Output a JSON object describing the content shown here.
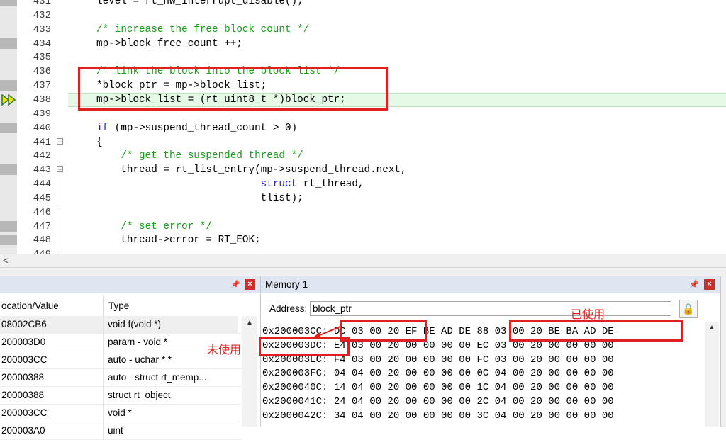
{
  "editor": {
    "lines": [
      {
        "num": "431",
        "code": "level = rt_hw_interrupt_disable();",
        "kind": "code",
        "marker": "bp"
      },
      {
        "num": "432",
        "code": "",
        "kind": "code",
        "marker": "none"
      },
      {
        "num": "433",
        "code": "/* increase the free block count */",
        "kind": "comment",
        "marker": "none"
      },
      {
        "num": "434",
        "code": "mp->block_free_count ++;",
        "kind": "code",
        "marker": "bp"
      },
      {
        "num": "435",
        "code": "",
        "kind": "code",
        "marker": "none"
      },
      {
        "num": "436",
        "code": "/* link the block into the block list */",
        "kind": "comment",
        "marker": "none"
      },
      {
        "num": "437",
        "code": "*block_ptr = mp->block_list;",
        "kind": "code",
        "marker": "bp"
      },
      {
        "num": "438",
        "code": "mp->block_list = (rt_uint8_t *)block_ptr;",
        "kind": "code",
        "marker": "current"
      },
      {
        "num": "439",
        "code": "",
        "kind": "code",
        "marker": "none"
      },
      {
        "num": "440",
        "code": "if (mp->suspend_thread_count > 0)",
        "kind": "if",
        "marker": "bp"
      },
      {
        "num": "441",
        "code": "{",
        "kind": "code",
        "marker": "none"
      },
      {
        "num": "442",
        "code": "    /* get the suspended thread */",
        "kind": "comment",
        "marker": "none"
      },
      {
        "num": "443",
        "code": "    thread = rt_list_entry(mp->suspend_thread.next,",
        "kind": "code",
        "marker": "bp"
      },
      {
        "num": "444",
        "code": "                           struct rt_thread,",
        "kind": "struct",
        "marker": "none"
      },
      {
        "num": "445",
        "code": "                           tlist);",
        "kind": "code",
        "marker": "none"
      },
      {
        "num": "446",
        "code": "",
        "kind": "code",
        "marker": "none"
      },
      {
        "num": "447",
        "code": "    /* set error */",
        "kind": "comment",
        "marker": "bp"
      },
      {
        "num": "448",
        "code": "    thread->error = RT_EOK;",
        "kind": "code",
        "marker": "bp"
      },
      {
        "num": "449",
        "code": "",
        "kind": "code",
        "marker": "none"
      }
    ]
  },
  "locals": {
    "col_location": "ocation/Value",
    "col_type": "Type",
    "rows": [
      {
        "value": "08002CB6",
        "type": "void f(void *)"
      },
      {
        "value": "200003D0",
        "type": "param - void *"
      },
      {
        "value": "200003CC",
        "type": "auto - uchar * *"
      },
      {
        "value": "20000388",
        "type": "auto - struct rt_memp..."
      },
      {
        "value": "20000388",
        "type": "struct rt_object"
      },
      {
        "value": "200003CC",
        "type": "void *"
      },
      {
        "value": "200003A0",
        "type": "uint"
      }
    ]
  },
  "memory": {
    "title": "Memory 1",
    "address_label": "Address:",
    "address_value": "block_ptr",
    "rows": [
      "0x200003CC: DC 03 00 20 EF BE AD DE 88 03 00 20 BE BA AD DE",
      "0x200003DC: E4 03 00 20 00 00 00 00 EC 03 00 20 00 00 00 00",
      "0x200003EC: F4 03 00 20 00 00 00 00 FC 03 00 20 00 00 00 00",
      "0x200003FC: 04 04 00 20 00 00 00 00 0C 04 00 20 00 00 00 00",
      "0x2000040C: 14 04 00 20 00 00 00 00 1C 04 00 20 00 00 00 00",
      "0x2000041C: 24 04 00 20 00 00 00 00 2C 04 00 20 00 00 00 00",
      "0x2000042C: 34 04 00 20 00 00 00 00 3C 04 00 20 00 00 00 00"
    ]
  },
  "annotations": {
    "used_label": "已使用",
    "unused_label": "未使用"
  },
  "colors": {
    "annotation_red": "#e02020",
    "comment_green": "#1a9e1a",
    "keyword_blue": "#1a1aff",
    "panel_header": "#dfe6f1"
  }
}
